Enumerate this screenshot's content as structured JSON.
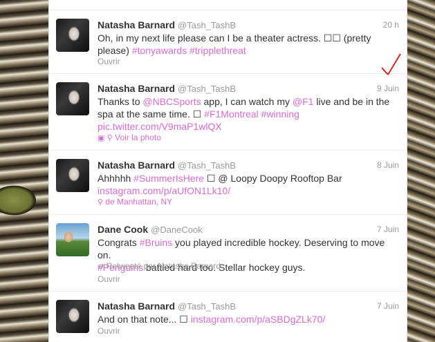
{
  "tweets": [
    {
      "name": "Natasha Barnard",
      "handle": "@Tash_TashB",
      "time": "20 h",
      "line1": "Oh, in my next life please can I be a theater actress. ☐☐ (pretty",
      "line2_text": "please) ",
      "hashtags": [
        "#tonyawards",
        "#tripplethreat"
      ],
      "action": "Ouvrir"
    },
    {
      "name": "Natasha Barnard",
      "handle": "@Tash_TashB",
      "time": "9 Juin",
      "l1_a": "Thanks to ",
      "mention1": "@NBCSports",
      "l1_b": " app, I can watch my ",
      "mention2": "@F1",
      "l1_c": " live and be in the",
      "l2_a": "spa at the same time. ☐ ",
      "hashtag1": "#F1Montreal",
      "hashtag2": "#winning",
      "url": "pic.twitter.com/V9maP1wlQX",
      "action": "Voir la photo"
    },
    {
      "name": "Natasha Barnard",
      "handle": "@Tash_TashB",
      "time": "8 Juin",
      "l1_a": "Ahhhhh ",
      "hashtag1": "#SummerIsHere",
      "l1_b": " ☐ @ Loopy Doopy Rooftop Bar",
      "url": "instagram.com/p/aUfON1Lk10/",
      "location": "de Manhattan, NY"
    },
    {
      "name": "Dane Cook",
      "handle": "@DaneCook",
      "time": "7 Juin",
      "l1_a": "Congrats ",
      "hashtag1": "#Bruins",
      "l1_b": " you played incredible hockey. Deserving to move on.",
      "hashtag2": "#Penguins",
      "l2_b": " battled hard too. Stellar hockey guys.",
      "retweeted": "Retweeté par Natasha Barnard",
      "action": "Ouvrir"
    },
    {
      "name": "Natasha Barnard",
      "handle": "@Tash_TashB",
      "time": "7 Juin",
      "l1_a": "And on that note... ☐ ",
      "url": "instagram.com/p/aSBDgZLk70/",
      "action": "Ouvrir"
    }
  ],
  "colors": {
    "link": "#d66bd0",
    "annotation": "#e01010"
  }
}
